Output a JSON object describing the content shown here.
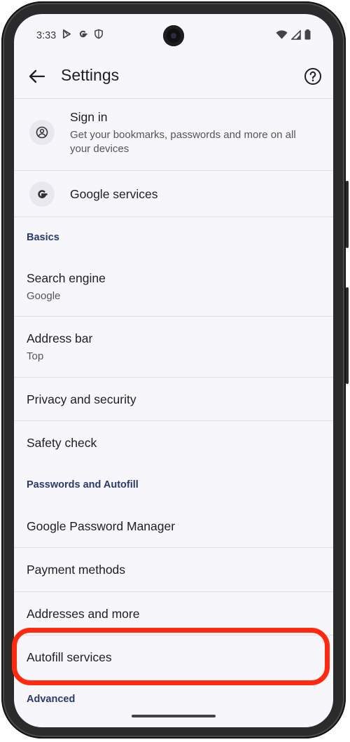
{
  "status": {
    "time": "3:33",
    "left_icons": [
      "play-store-icon",
      "google-icon",
      "shield-icon"
    ],
    "right_icons": [
      "wifi-icon",
      "signal-icon",
      "battery-icon"
    ]
  },
  "appbar": {
    "title": "Settings"
  },
  "account": {
    "sign_in_title": "Sign in",
    "sign_in_subtitle": "Get your bookmarks, passwords and more on all your devices",
    "google_services": "Google services"
  },
  "sections": {
    "basics": "Basics",
    "passwords_autofill": "Passwords and Autofill",
    "advanced": "Advanced"
  },
  "basics_items": {
    "search_engine": "Search engine",
    "search_engine_value": "Google",
    "address_bar": "Address bar",
    "address_bar_value": "Top",
    "privacy": "Privacy and security",
    "safety": "Safety check"
  },
  "autofill_items": {
    "password_manager": "Google Password Manager",
    "payment_methods": "Payment methods",
    "addresses": "Addresses and more",
    "autofill_services": "Autofill services"
  },
  "colors": {
    "highlight": "#ff2a10",
    "section_header": "#2a3a6b",
    "screen_bg": "#f7f6fb"
  }
}
